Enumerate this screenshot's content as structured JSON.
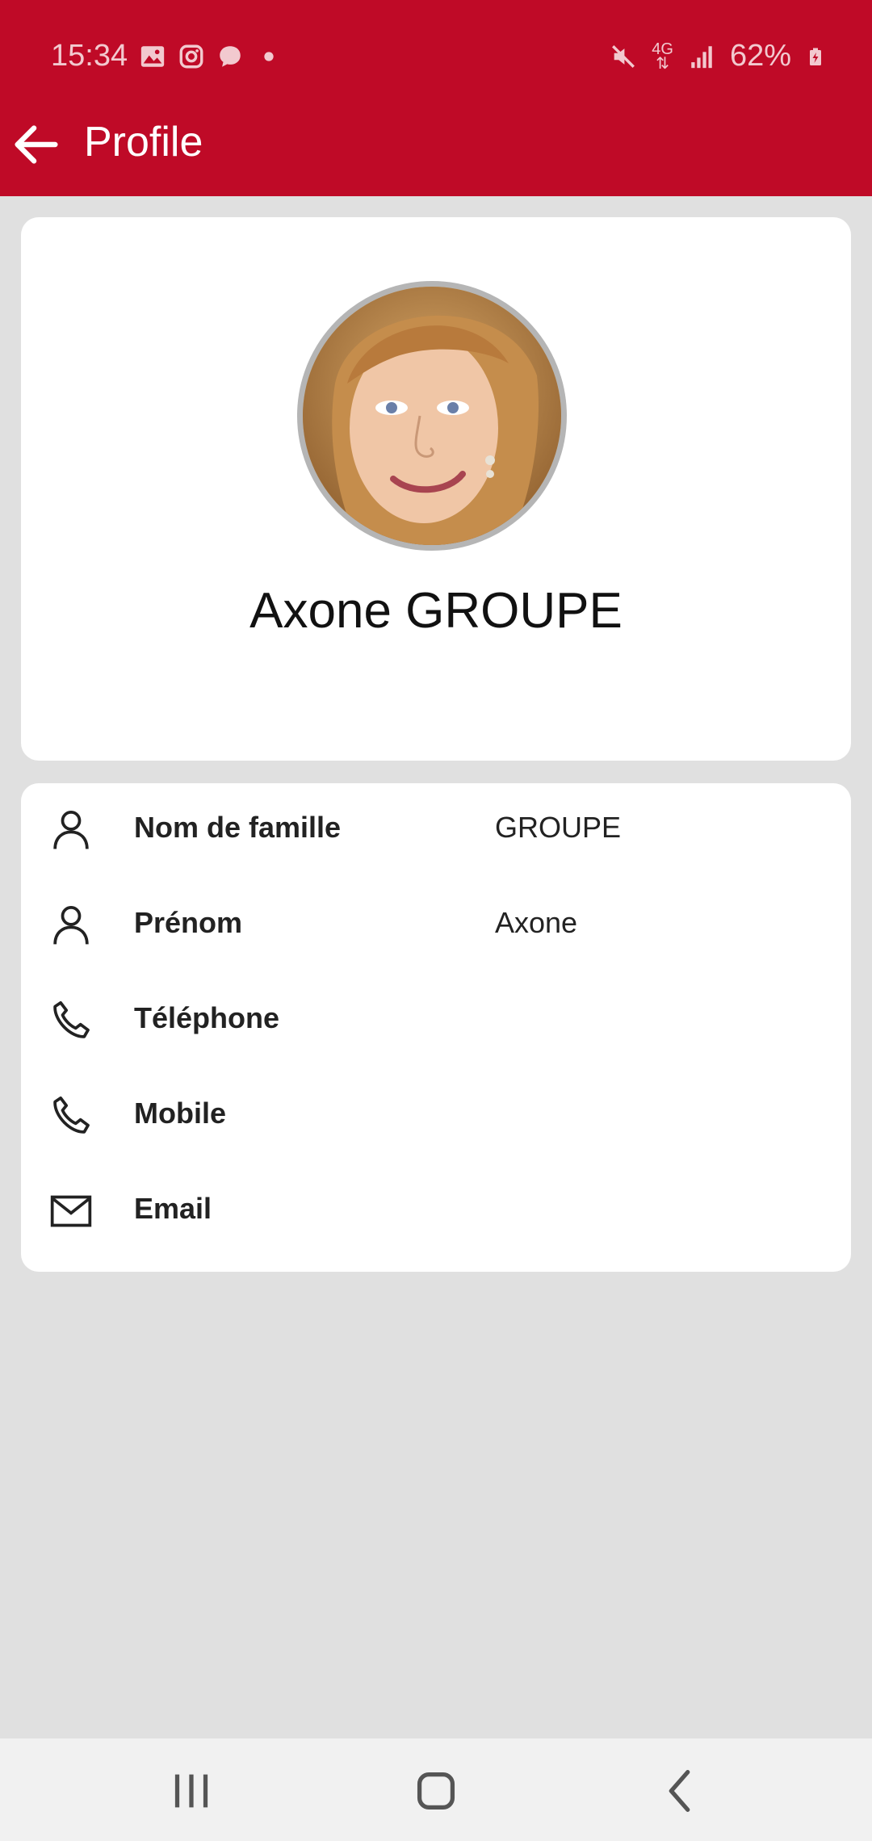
{
  "status_bar": {
    "time": "15:34",
    "network": "4G",
    "battery": "62%",
    "icons_left": [
      "gallery-icon",
      "instagram-icon",
      "chat-icon",
      "dot-icon"
    ],
    "icons_right": [
      "mute-icon",
      "network-4g-icon",
      "signal-icon",
      "battery-charging-icon"
    ]
  },
  "header": {
    "title": "Profile",
    "back_icon": "arrow-left-icon"
  },
  "profile": {
    "display_name": "Axone GROUPE"
  },
  "details": [
    {
      "icon": "person-icon",
      "label": "Nom de famille",
      "value": "GROUPE"
    },
    {
      "icon": "person-icon",
      "label": "Prénom",
      "value": "Axone"
    },
    {
      "icon": "phone-icon",
      "label": "Téléphone",
      "value": ""
    },
    {
      "icon": "phone-icon",
      "label": "Mobile",
      "value": ""
    },
    {
      "icon": "mail-icon",
      "label": "Email",
      "value": ""
    }
  ],
  "nav_bar": {
    "buttons": [
      "recents-icon",
      "home-icon",
      "back-icon"
    ]
  },
  "colors": {
    "primary": "#bf0a27",
    "background": "#e0e0e0",
    "card": "#ffffff"
  }
}
